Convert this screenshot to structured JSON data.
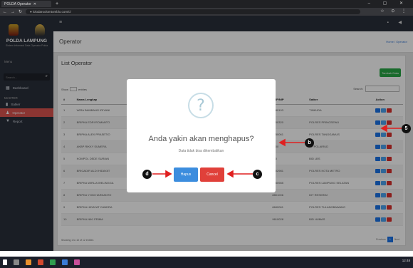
{
  "browser": {
    "tab_title": "POLDA Operator",
    "url": "● lolodaroolomtomblo.com/c/"
  },
  "sidebar": {
    "brand": "POLDA LAMPUNG",
    "brand_sub": "Sistem Informasi Data Operator Polda",
    "section_menu": "Menu",
    "search_placeholder": "Search...",
    "section_master": "MASTER",
    "items": [
      {
        "label": "Dashboard"
      },
      {
        "label": "Satker"
      },
      {
        "label": "Operator"
      },
      {
        "label": "Report"
      }
    ]
  },
  "header": {
    "page_title": "Operator",
    "breadcrumb": "Home / Operator"
  },
  "panel": {
    "title": "List Operator",
    "add_button": "Tambah Data",
    "show_label": "Show",
    "entries_label": "entries",
    "search_label": "Search:",
    "columns": [
      "#",
      "Nama Lengkap",
      "",
      "",
      "",
      "NRP/NIP",
      "Satker",
      "Action"
    ],
    "rows": [
      {
        "no": "1",
        "name": "WIRA BAMBANG IRIYANI",
        "nrp": "2580193",
        "satker": "TINKUDA"
      },
      {
        "no": "2",
        "name": "BRIPKA EDRI ROMANTO",
        "nrp": "9400320",
        "satker": "POLRES PRINGSEWU"
      },
      {
        "no": "3",
        "name": "BRIPKA ALEX PRASETIO",
        "nrp": "5950061",
        "satker": "POLRES TANGGAMUS"
      },
      {
        "no": "4",
        "name": "AKBP RIKKY SUMERA",
        "nrp": "9400",
        "satker": "DITPOLAIRUD"
      },
      {
        "no": "5",
        "name": "KOMPOL DEDE SURIAN",
        "nrp": "210",
        "satker": "BID LBS"
      },
      {
        "no": "6",
        "name": "BRIGADIR ALDI HIDAYAT",
        "nrp": "9502981",
        "satker": "POLRES KOTA METRO"
      },
      {
        "no": "7",
        "name": "BRIPKA WIRLIA WELINGGA",
        "nrp": "8750985",
        "satker": "POLRES LAMPUNG SELATAN"
      },
      {
        "no": "8",
        "name": "BRIPKA YONI HARDANTO",
        "nrp": "8801006",
        "satker": "DIT RESKRIM"
      },
      {
        "no": "9",
        "name": "BRIPKA HIDAYAT CANDRA",
        "nrp": "8840061",
        "satker": "POLRES TULANGBAWANG"
      },
      {
        "no": "10",
        "name": "BRIPKA NIKI PRIMA",
        "nrp": "9610028",
        "satker": "BID HUMAS"
      }
    ],
    "info": "Showing 1 to 10 of 12 entries",
    "pager_prev": "Previous",
    "pager_page": "1",
    "pager_next": "Next"
  },
  "modal": {
    "icon": "?",
    "title": "Anda yakin akan menghapus?",
    "text": "Data tidak bisa dikembalikan",
    "confirm_label": "Hapus",
    "cancel_label": "Cancel"
  },
  "annotations": {
    "b": "b",
    "c": "c",
    "d": "d",
    "e": "5"
  },
  "taskbar": {
    "clock": "12:48"
  }
}
